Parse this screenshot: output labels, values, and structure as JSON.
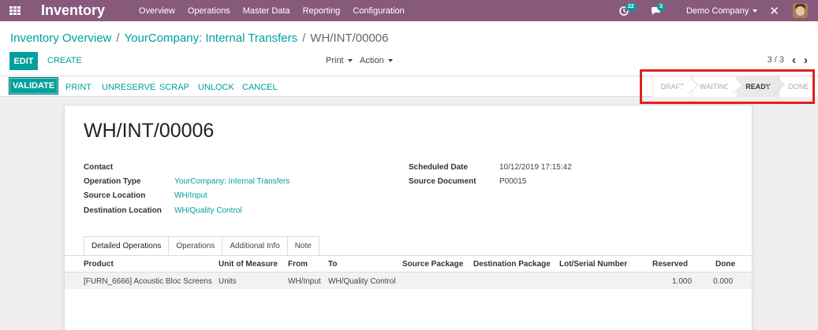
{
  "navbar": {
    "app_name": "Inventory",
    "menu": [
      "Overview",
      "Operations",
      "Master Data",
      "Reporting",
      "Configuration"
    ],
    "activity_count": "22",
    "message_count": "3",
    "company": "Demo Company",
    "activity_icon": "clock-icon",
    "message_icon": "chat-icon"
  },
  "breadcrumb": {
    "items": [
      "Inventory Overview",
      "YourCompany: Internal Transfers"
    ],
    "separator": "/",
    "current": "WH/INT/00006"
  },
  "control_panel": {
    "edit_label": "EDIT",
    "create_label": "CREATE",
    "print_label": "Print",
    "action_label": "Action",
    "pager": "3 / 3"
  },
  "statusbar": {
    "buttons": [
      "VALIDATE",
      "PRINT",
      "UNRESERVE",
      "SCRAP",
      "UNLOCK",
      "CANCEL"
    ],
    "stages": [
      "DRAFT",
      "WAITING",
      "READY",
      "DONE"
    ],
    "active_stage": "READY"
  },
  "record": {
    "name": "WH/INT/00006",
    "left_fields": [
      {
        "label": "Contact",
        "value": ""
      },
      {
        "label": "Operation Type",
        "value": "YourCompany: Internal Transfers"
      },
      {
        "label": "Source Location",
        "value": "WH/Input"
      },
      {
        "label": "Destination Location",
        "value": "WH/Quality Control"
      }
    ],
    "right_fields": [
      {
        "label": "Scheduled Date",
        "value": "10/12/2019 17:15:42"
      },
      {
        "label": "Source Document",
        "value": "P00015"
      }
    ]
  },
  "tabs": [
    "Detailed Operations",
    "Operations",
    "Additional Info",
    "Note"
  ],
  "table": {
    "columns": [
      "Product",
      "Unit of Measure",
      "From",
      "To",
      "Source Package",
      "Destination Package",
      "Lot/Serial Number",
      "Reserved",
      "Done"
    ],
    "rows": [
      [
        "[FURN_6666] Acoustic Bloc Screens",
        "Units",
        "WH/Input",
        "WH/Quality Control",
        "",
        "",
        "",
        "1.000",
        "0.000"
      ]
    ]
  },
  "colors": {
    "navbar": "#875a7b",
    "accent": "#00a09d",
    "highlight": "#e02020"
  }
}
